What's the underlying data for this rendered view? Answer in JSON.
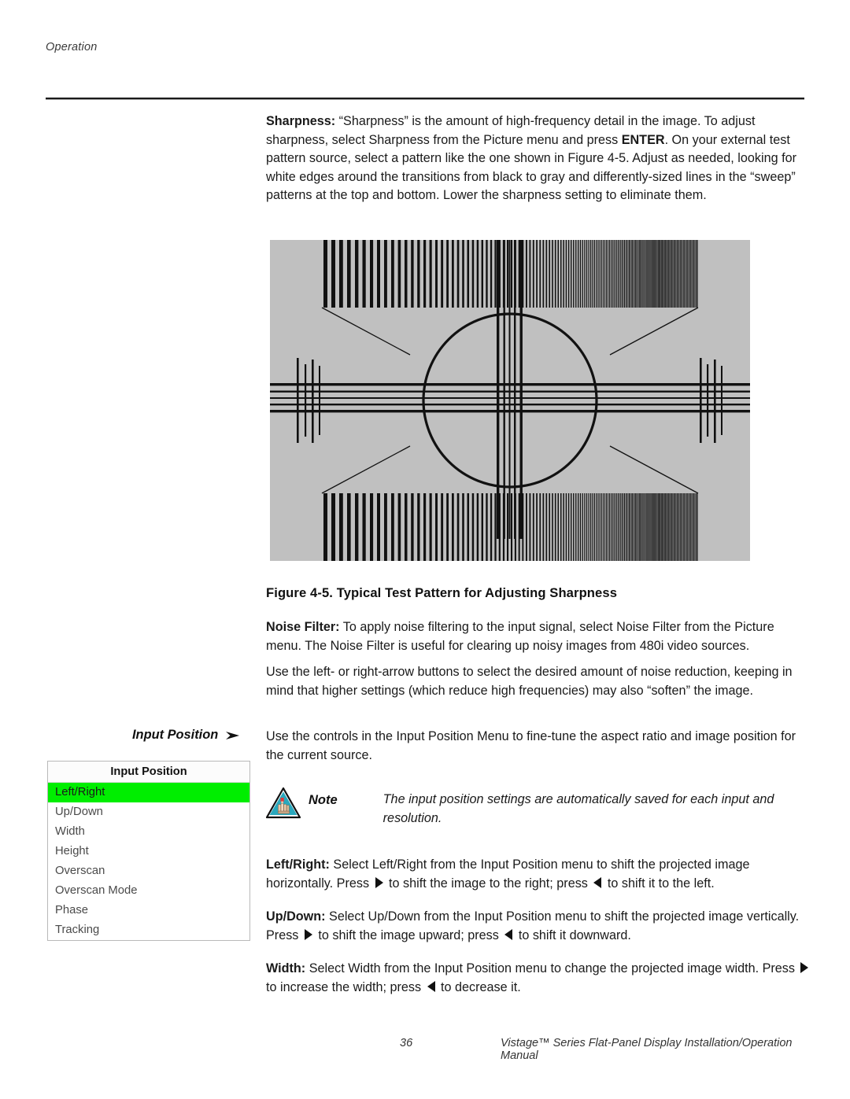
{
  "page": {
    "running_head": "Operation",
    "footer_page_number": "36",
    "footer_title": "Vistage™ Series Flat-Panel Display Installation/Operation Manual"
  },
  "content": {
    "sharpness_label": "Sharpness:",
    "sharpness_body_1": " “Sharpness” is the amount of high-frequency detail in the image. To adjust sharpness, select Sharpness from the Picture menu and press ",
    "sharpness_enter": "ENTER",
    "sharpness_body_2": ". On your external test pattern source, select a pattern like the one shown in Figure 4-5. Adjust as needed, looking for white edges around the transitions from black to gray and differently-sized lines in the “sweep” patterns at the top and bottom. Lower the sharpness setting to eliminate them.",
    "figure_caption": "Figure 4-5. Typical Test Pattern for Adjusting Sharpness",
    "noise_filter_label": "Noise Filter:",
    "noise_filter_body": " To apply noise filtering to the input signal, select Noise Filter from the Picture menu. The Noise Filter is useful for clearing up noisy images from 480i video sources.",
    "noise_reduction_body": "Use the left- or right-arrow buttons to select the desired amount of noise reduction, keeping in mind that higher settings (which reduce high frequencies) may also “soften” the image.",
    "input_position_intro": "Use the controls in the Input Position Menu to fine-tune the aspect ratio and image position for the current source.",
    "left_right_label": "Left/Right:",
    "left_right_body_1": " Select Left/Right from the Input Position menu to shift the projected image horizontally. Press ",
    "left_right_body_2": " to shift the image to the right; press ",
    "left_right_body_3": " to shift it to the left.",
    "up_down_label": "Up/Down:",
    "up_down_body_1": " Select Up/Down from the Input Position menu to shift the projected image vertically. Press ",
    "up_down_body_2": " to shift the image upward; press ",
    "up_down_body_3": " to shift it downward.",
    "width_label": "Width:",
    "width_body_1": " Select Width from the Input Position menu to change the projected image width. Press ",
    "width_body_2": " to increase the width; press ",
    "width_body_3": " to decrease it."
  },
  "margin_heading": {
    "label": "Input Position",
    "arrow_icon": "arrow-right-icon"
  },
  "osd_menu": {
    "title": "Input Position",
    "selected_index": 0,
    "highlight_color": "#00ee00",
    "items": [
      {
        "label": "Left/Right",
        "selected": true
      },
      {
        "label": "Up/Down",
        "selected": false
      },
      {
        "label": "Width",
        "selected": false
      },
      {
        "label": "Height",
        "selected": false
      },
      {
        "label": "Overscan",
        "selected": false
      },
      {
        "label": "Overscan Mode",
        "selected": false
      },
      {
        "label": "Phase",
        "selected": false
      },
      {
        "label": "Tracking",
        "selected": false
      }
    ]
  },
  "note": {
    "icon": "note-triangle-hand-icon",
    "icon_fill": "#2aa8bd",
    "label": "Note",
    "text": "The input position settings are automatically saved for each input and resolution."
  },
  "figure": {
    "alt_name": "sharpness-test-pattern",
    "background_color": "#c0c0c0",
    "line_color": "#111111",
    "elements": [
      "top-frequency-sweep-bars",
      "bottom-frequency-sweep-bars",
      "center-circle",
      "horizontal-multiburst-lines",
      "vertical-multiburst-lines",
      "diagonal-corner-lines"
    ]
  }
}
